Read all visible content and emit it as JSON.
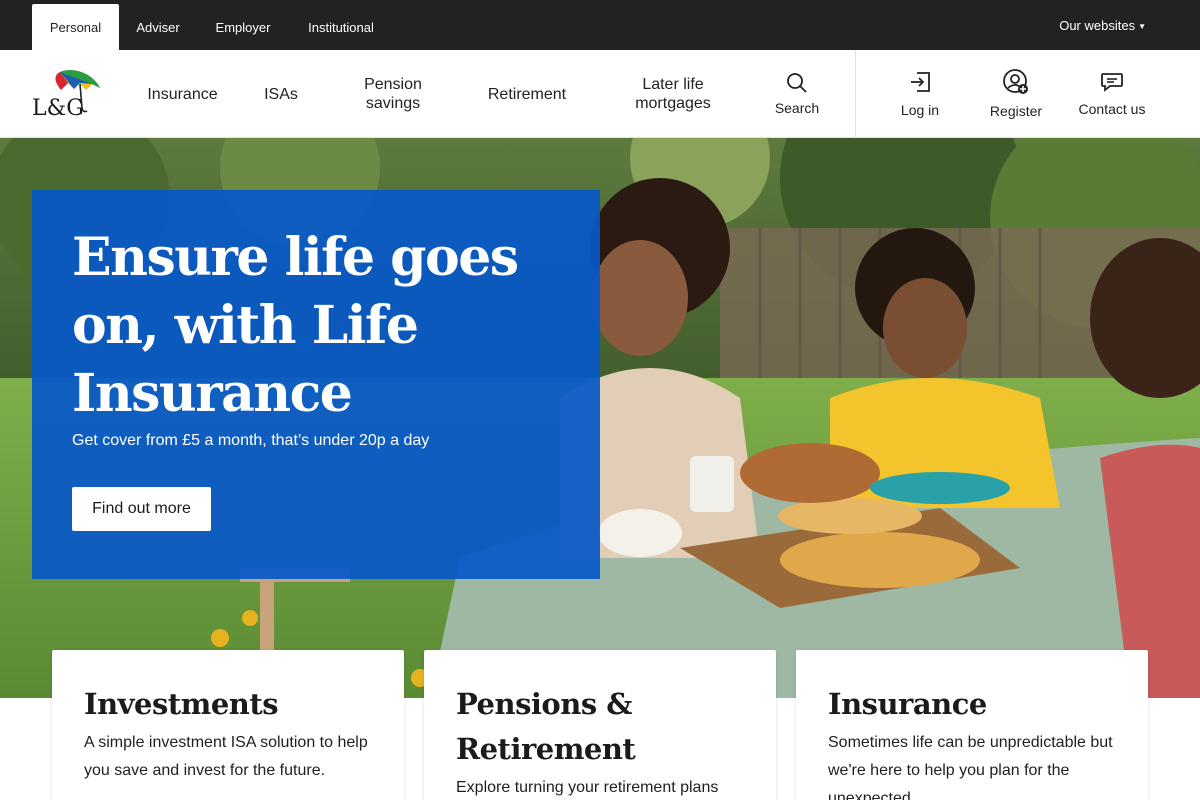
{
  "audience_tabs": [
    {
      "label": "Personal",
      "active": true
    },
    {
      "label": "Adviser",
      "active": false
    },
    {
      "label": "Employer",
      "active": false
    },
    {
      "label": "Institutional",
      "active": false
    }
  ],
  "our_websites": {
    "label": "Our websites",
    "icon": "chevron-down-icon"
  },
  "logo": {
    "text": "L&G",
    "icon": "umbrella-icon"
  },
  "nav": {
    "items": [
      {
        "label": "Insurance"
      },
      {
        "label": "ISAs"
      },
      {
        "label": "Pension savings"
      },
      {
        "label": "Retirement"
      },
      {
        "label": "Later life mortgages"
      }
    ],
    "search": {
      "label": "Search",
      "icon": "search-icon"
    },
    "login": {
      "label": "Log in",
      "icon": "login-icon"
    },
    "register": {
      "label": "Register",
      "icon": "register-user-icon"
    },
    "contact": {
      "label": "Contact us",
      "icon": "chat-icon"
    }
  },
  "hero": {
    "title": "Ensure life goes on, with Life Insurance",
    "subtitle": "Get cover from £5 a month, that’s under 20p a day",
    "cta": "Find out more",
    "panel_color": "#0858c8"
  },
  "cards": [
    {
      "title": "Investments",
      "text": "A simple investment ISA solution to help you save and invest for the future."
    },
    {
      "title": "Pensions & Retirement",
      "text": "Explore turning your retirement plans into reality."
    },
    {
      "title": "Insurance",
      "text": "Sometimes life can be unpredictable but we're here to help you plan for the unexpected."
    }
  ],
  "colors": {
    "topbar": "#222222",
    "brand_blue": "#0858c8"
  }
}
